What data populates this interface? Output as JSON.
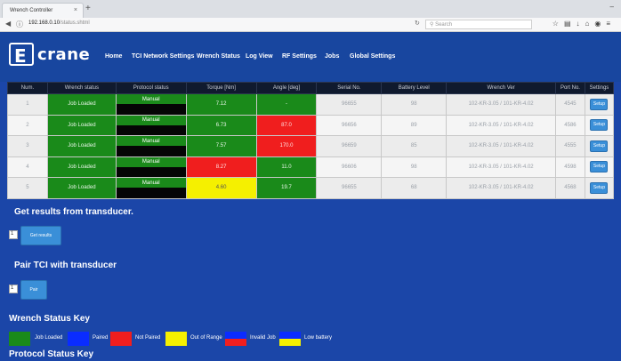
{
  "browser": {
    "tab_title": "Wrench Controller",
    "tab_close": "×",
    "new_tab": "+",
    "window_control": "–",
    "url_host": "192.168.0.10",
    "url_path": "/status.shtml",
    "search_placeholder": "Search"
  },
  "header": {
    "logo_mark": "E",
    "logo_text": "crane",
    "nav": [
      "Home",
      "TCI Network Settings",
      "Wrench Status",
      "Log View",
      "RF Settings",
      "Jobs",
      "Global Settings"
    ]
  },
  "table": {
    "headers": [
      "Num.",
      "Wrench status",
      "Protocol status",
      "Torque [Nm]",
      "Angle [deg]",
      "Serial No.",
      "Battery Level",
      "Wrench Ver",
      "Port No.",
      "Settings"
    ],
    "rows": [
      {
        "num": "1",
        "wrench_status": "Job Loaded",
        "protocol": "Manual",
        "torque": "7.12",
        "angle": "-",
        "serial": "96655",
        "battery": "98",
        "ver": "102-KR-3.05 / 101-KR-4.02",
        "port": "4545",
        "setup": "Setup"
      },
      {
        "num": "2",
        "wrench_status": "Job Loaded",
        "protocol": "Manual",
        "torque": "6.73",
        "angle": "87.0",
        "serial": "96656",
        "battery": "89",
        "ver": "102-KR-3.05 / 101-KR-4.02",
        "port": "4586",
        "setup": "Setup"
      },
      {
        "num": "3",
        "wrench_status": "Job Loaded",
        "protocol": "Manual",
        "torque": "7.57",
        "angle": "170.0",
        "serial": "96659",
        "battery": "85",
        "ver": "102-KR-3.05 / 101-KR-4.02",
        "port": "4555",
        "setup": "Setup"
      },
      {
        "num": "4",
        "wrench_status": "Job Loaded",
        "protocol": "Manual",
        "torque": "8.27",
        "angle": "11.0",
        "serial": "96606",
        "battery": "98",
        "ver": "102-KR-3.05 / 101-KR-4.02",
        "port": "4598",
        "setup": "Setup"
      },
      {
        "num": "5",
        "wrench_status": "Job Loaded",
        "protocol": "Manual",
        "torque": "4.60",
        "angle": "19.7",
        "serial": "96655",
        "battery": "68",
        "ver": "102-KR-3.05 / 101-KR-4.02",
        "port": "4568",
        "setup": "Setup"
      }
    ]
  },
  "get_results": {
    "title": "Get results from transducer.",
    "input_value": "1",
    "button": "Get results"
  },
  "pair": {
    "title": "Pair TCI with transducer",
    "input_value": "1",
    "button": "Pair"
  },
  "key": {
    "title": "Wrench Status Key",
    "items": [
      {
        "label": "Job Loaded",
        "color": "#1a8a1a"
      },
      {
        "label": "Paired",
        "color": "#0a2cff"
      },
      {
        "label": "Not Paired",
        "color": "#f01e1e"
      },
      {
        "label": "Out of Range",
        "color": "#f5f000"
      },
      {
        "label": "Invalid Job",
        "color_top": "#0a2cff",
        "color_bottom": "#f01e1e"
      },
      {
        "label": "Low battery",
        "color_top": "#0a2cff",
        "color_bottom": "#f5f000"
      }
    ]
  },
  "protocol_key": {
    "title": "Protocol Status Key"
  },
  "colors": {
    "green": "#1a8a1a",
    "red": "#f01e1e",
    "yellow": "#f5f000",
    "page_blue": "#1b46a8"
  }
}
